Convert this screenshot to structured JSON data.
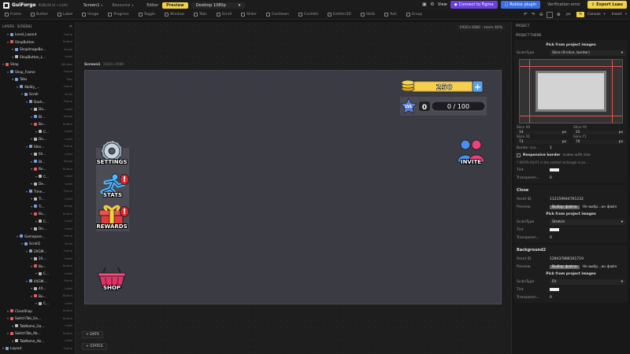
{
  "app": {
    "name": "GuiForge",
    "sub": "ROBLOX UI • LUAU",
    "screen_select": "Screen1",
    "resource_select": "Resource",
    "modes": [
      "Editor",
      "Preview"
    ],
    "device": "Desktop 1080p",
    "view": "View",
    "figma_btn": "Connect to Figma",
    "roblox_btn": "Roblox plugin",
    "verify": "Verification error",
    "export_btn": "Export Luau"
  },
  "toolbar": {
    "tools": [
      "Frame",
      "Button",
      "Label",
      "Image",
      "Progress",
      "Toggle",
      "Window",
      "Tabs",
      "Scroll",
      "Slider",
      "Cooldown",
      "Confetti",
      "Emitter3D",
      "Skills",
      "Roll",
      "Group"
    ],
    "units": [
      "px",
      "%"
    ],
    "canvas": "Canvas",
    "insert": "Insert"
  },
  "layers": {
    "header": "LAYERS · SCREEN1",
    "items": [
      {
        "name": "Level_Layout",
        "type": "Frame",
        "indent": 1,
        "color": "#7aa0e0"
      },
      {
        "name": "ShopButton",
        "type": "Button",
        "indent": 1,
        "color": "#e06060"
      },
      {
        "name": "ShopImageBu…",
        "type": "Image",
        "indent": 2,
        "color": "#7aa0e0"
      },
      {
        "name": "ShopButton_L…",
        "type": "Label",
        "indent": 2,
        "color": "#bbb"
      },
      {
        "name": "Shop",
        "type": "Window",
        "indent": 0,
        "color": "#e06060"
      },
      {
        "name": "Shop_Frame",
        "type": "Frame",
        "indent": 1,
        "color": "#7aa0e0"
      },
      {
        "name": "Tabs",
        "type": "Tabs",
        "indent": 2,
        "color": "#7aa0e0"
      },
      {
        "name": "Ability_…",
        "type": "Frame",
        "indent": 3,
        "color": "#7aa0e0"
      },
      {
        "name": "Scroll",
        "type": "Scroll",
        "indent": 4,
        "color": "#7aa0e0"
      },
      {
        "name": "Dash…",
        "type": "Frame",
        "indent": 5,
        "color": "#7aa0e0"
      },
      {
        "name": "Da…",
        "type": "Label",
        "indent": 6,
        "color": "#bbb"
      },
      {
        "name": "Bl…",
        "type": "Image",
        "indent": 6,
        "color": "#7aa0e0"
      },
      {
        "name": "Bu…",
        "type": "Button",
        "indent": 6,
        "color": "#e06060"
      },
      {
        "name": "C…",
        "type": "Label",
        "indent": 7,
        "color": "#bbb"
      },
      {
        "name": "De…",
        "type": "Label",
        "indent": 6,
        "color": "#bbb"
      },
      {
        "name": "Shie…",
        "type": "Frame",
        "indent": 5,
        "color": "#7aa0e0"
      },
      {
        "name": "Sh…",
        "type": "Label",
        "indent": 6,
        "color": "#bbb"
      },
      {
        "name": "Bl…",
        "type": "Image",
        "indent": 6,
        "color": "#7aa0e0"
      },
      {
        "name": "Bu…",
        "type": "Button",
        "indent": 6,
        "color": "#e06060"
      },
      {
        "name": "C…",
        "type": "Label",
        "indent": 7,
        "color": "#bbb"
      },
      {
        "name": "De…",
        "type": "Label",
        "indent": 6,
        "color": "#bbb"
      },
      {
        "name": "Time…",
        "type": "Frame",
        "indent": 5,
        "color": "#7aa0e0"
      },
      {
        "name": "Ti…",
        "type": "Label",
        "indent": 6,
        "color": "#bbb"
      },
      {
        "name": "Ti…",
        "type": "Image",
        "indent": 6,
        "color": "#7aa0e0"
      },
      {
        "name": "Bu…",
        "type": "Button",
        "indent": 6,
        "color": "#e06060"
      },
      {
        "name": "C…",
        "type": "Label",
        "indent": 7,
        "color": "#bbb"
      },
      {
        "name": "De…",
        "type": "Label",
        "indent": 6,
        "color": "#bbb"
      },
      {
        "name": "Gamepass…",
        "type": "Frame",
        "indent": 3,
        "color": "#7aa0e0"
      },
      {
        "name": "Scroll2",
        "type": "Scroll",
        "indent": 4,
        "color": "#7aa0e0"
      },
      {
        "name": "2XGM…",
        "type": "Frame",
        "indent": 5,
        "color": "#7aa0e0"
      },
      {
        "name": "2X…",
        "type": "Label",
        "indent": 6,
        "color": "#bbb"
      },
      {
        "name": "Bu…",
        "type": "Button",
        "indent": 6,
        "color": "#e06060"
      },
      {
        "name": "C…",
        "type": "Label",
        "indent": 7,
        "color": "#bbb"
      },
      {
        "name": "4XGM…",
        "type": "Frame",
        "indent": 5,
        "color": "#7aa0e0"
      },
      {
        "name": "4X…",
        "type": "Label",
        "indent": 6,
        "color": "#bbb"
      },
      {
        "name": "Bu…",
        "type": "Button",
        "indent": 6,
        "color": "#e06060"
      },
      {
        "name": "C…",
        "type": "Label",
        "indent": 7,
        "color": "#bbb"
      },
      {
        "name": "CloseShop",
        "type": "Button",
        "indent": 1,
        "color": "#e06060"
      },
      {
        "name": "SwitchTab_Ga…",
        "type": "Button",
        "indent": 1,
        "color": "#e06060"
      },
      {
        "name": "TabName_Ga…",
        "type": "Label",
        "indent": 2,
        "color": "#bbb"
      },
      {
        "name": "SwitchTab_Ab…",
        "type": "Button",
        "indent": 1,
        "color": "#e06060"
      },
      {
        "name": "TabName_Ab…",
        "type": "Label",
        "indent": 2,
        "color": "#bbb"
      },
      {
        "name": "Layout",
        "type": "Frame",
        "indent": 0,
        "color": "#7aa0e0"
      }
    ]
  },
  "canvas": {
    "info": "1920×1080 · zoom 46%",
    "screen_name": "Screen1",
    "screen_size": "1920×1080",
    "coins": "250",
    "level": "0",
    "lvl_label": "LVL",
    "xp": "0 / 100",
    "buttons": {
      "settings": "SETTINGS",
      "stats": "STATS",
      "rewards": "REWARDS",
      "shop": "SHOP",
      "invite": "INVITE"
    },
    "badge": "!",
    "data_btn": "+ DATA",
    "states_btn": "+ STATES"
  },
  "props": {
    "section": "PROJECT",
    "theme": "PROJECT THEME",
    "bg_block": {
      "pick": "Pick from project images",
      "scale_label": "ScaleType",
      "scale_value": "Slice (9-slice, border)",
      "slice_x0_label": "Slice X0",
      "slice_y0_label": "Slice Y0",
      "slice_x0": "14",
      "slice_y0": "15",
      "slice_x1_label": "Slice X1",
      "slice_y1_label": "Slice Y1",
      "slice_x1": "73",
      "slice_y1": "70",
      "unit": "px",
      "border_label": "Border sca…",
      "border_value": "1",
      "responsive": "Responsive border",
      "responsive_hint": "scales with size",
      "hint": "? X0/Y0–X1/Y1 is the control rectangle in px…",
      "tint_label": "Tint",
      "transp_label": "Transparen…",
      "transp_value": "0"
    },
    "close_block": {
      "title": "Close",
      "asset_label": "Asset ID",
      "asset_value": "112159944761232",
      "preview_label": "Preview",
      "file_btn": "Выбор файла",
      "file_text": "Не выбр…ан файл",
      "pick": "Pick from project images",
      "scale_label": "ScaleType",
      "scale_value": "Stretch",
      "tint_label": "Tint",
      "transp_label": "Transparen…",
      "transp_value": "0"
    },
    "bg2_block": {
      "title": "Background2",
      "asset_label": "Asset ID",
      "asset_value": "128437888161719",
      "preview_label": "Preview",
      "file_btn": "Выбор файла",
      "file_text": "Не выбр…ан файл",
      "pick": "Pick from project images",
      "scale_label": "ScaleType",
      "scale_value": "Fit",
      "tint_label": "Tint",
      "transp_label": "Transparen…",
      "transp_value": "0"
    }
  }
}
